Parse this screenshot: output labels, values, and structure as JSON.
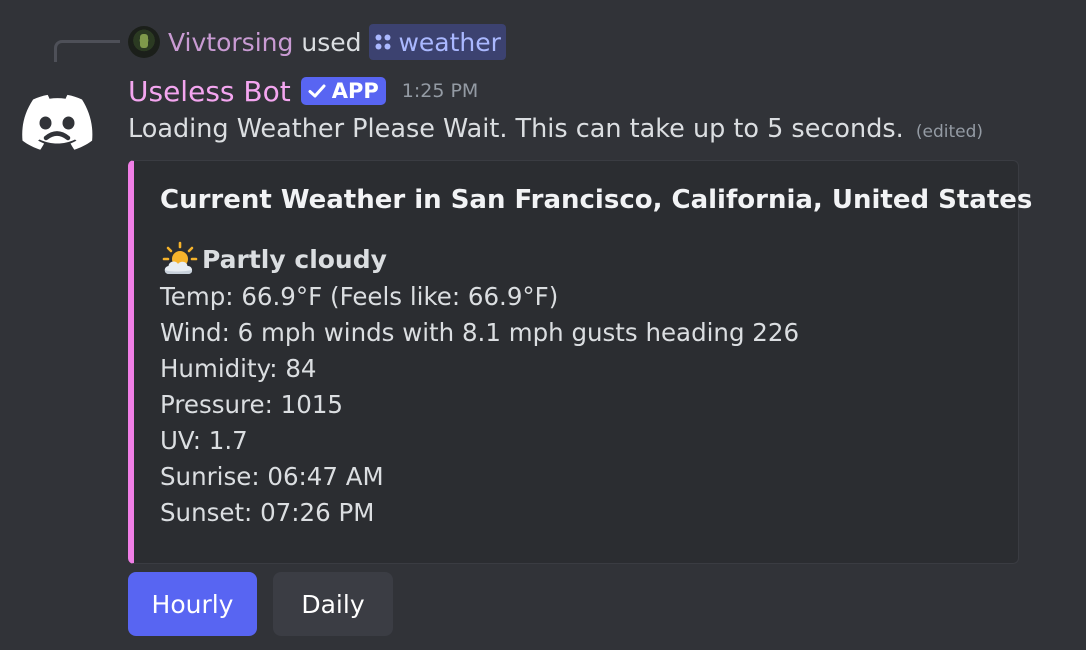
{
  "interaction": {
    "user": "Vivtorsing",
    "verb": "used",
    "command": "weather"
  },
  "message": {
    "author": "Useless Bot",
    "badge": "APP",
    "timestamp": "1:25 PM",
    "text": "Loading Weather Please Wait. This can take up to 5 seconds.",
    "edited": "(edited)"
  },
  "embed": {
    "accent_color": "#f07ee6",
    "title": "Current Weather in San Francisco, California, United States",
    "condition_icon": "sun-behind-cloud-icon",
    "condition": "Partly cloudy",
    "lines": [
      "Temp: 66.9°F (Feels like: 66.9°F)",
      "Wind: 6 mph winds with 8.1 mph gusts heading 226",
      "Humidity: 84",
      "Pressure: 1015",
      "UV: 1.7",
      "Sunrise: 06:47 AM",
      "Sunset: 07:26 PM"
    ]
  },
  "buttons": {
    "hourly": "Hourly",
    "daily": "Daily"
  },
  "colors": {
    "background": "#313338",
    "embed_background": "#2b2d31",
    "blurple": "#5865f2",
    "author_name": "#f4a6f0",
    "interaction_user": "#c99bd3",
    "command_chip_text": "#aab8ff"
  }
}
